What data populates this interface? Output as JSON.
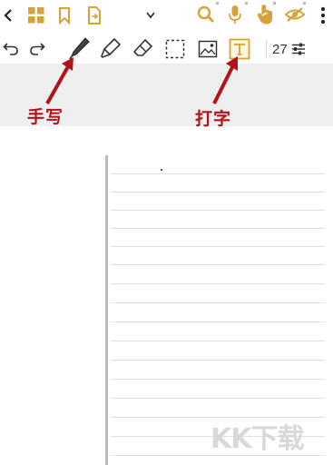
{
  "colors": {
    "accent": "#d8a23a",
    "annotation": "#b0141b",
    "band": "#efefef",
    "icon_dark": "#333333"
  },
  "topbar": {
    "icons": [
      "back-icon",
      "grid-icon",
      "bookmark-icon",
      "document-export-icon",
      "chevron-down-icon",
      "search-icon",
      "microphone-icon",
      "hand-touch-icon",
      "eye-hidden-icon",
      "more-vertical-icon"
    ]
  },
  "toolbar": {
    "icons": [
      "undo-icon",
      "redo-icon",
      "pen-icon",
      "highlighter-icon",
      "eraser-icon",
      "lasso-select-icon",
      "image-icon",
      "text-box-icon",
      "settings-sliders-icon"
    ],
    "font_size": "27"
  },
  "annotations": {
    "handwriting": "手写",
    "typing": "打字"
  },
  "watermark": "KK下载"
}
